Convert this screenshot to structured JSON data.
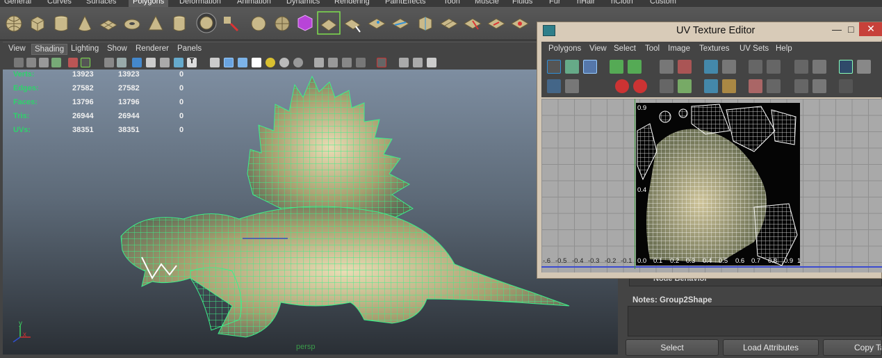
{
  "shelf": {
    "tabs": [
      "General",
      "Curves",
      "Surfaces",
      "Polygons",
      "Deformation",
      "Animation",
      "Dynamics",
      "Rendering",
      "PaintEffects",
      "Toon",
      "Muscle",
      "Fluids",
      "Fur",
      "nHair",
      "nCloth",
      "Custom"
    ],
    "active_tab": "Polygons"
  },
  "viewport": {
    "menu": [
      "View",
      "Shading",
      "Lighting",
      "Show",
      "Renderer",
      "Panels"
    ],
    "active_menu": "Shading",
    "camera_label": "persp",
    "axis": {
      "y": "y",
      "x": "x"
    },
    "hud": [
      {
        "label": "Verts:",
        "a": "13923",
        "b": "13923",
        "c": "0"
      },
      {
        "label": "Edges:",
        "a": "27582",
        "b": "27582",
        "c": "0"
      },
      {
        "label": "Faces:",
        "a": "13796",
        "b": "13796",
        "c": "0"
      },
      {
        "label": "Tris:",
        "a": "26944",
        "b": "26944",
        "c": "0"
      },
      {
        "label": "UVs:",
        "a": "38351",
        "b": "38351",
        "c": "0"
      }
    ]
  },
  "uv_editor": {
    "title": "UV Texture Editor",
    "window_controls": {
      "minimize": "—",
      "maximize": "□",
      "close": "✕"
    },
    "menu": [
      "Polygons",
      "View",
      "Select",
      "Tool",
      "Image",
      "Textures",
      "UV Sets",
      "Help"
    ],
    "x_ticks": [
      "-.6",
      "-0.5",
      "-0.4",
      "-0.3",
      "-0.2",
      "-0.1",
      "0.0",
      "0.1",
      "0.2",
      "0.3",
      "0.4",
      "0.5",
      "0.6",
      "0.7",
      "0.8",
      "0.9",
      "1"
    ],
    "y_ticks": [
      "0.9",
      "0.4"
    ]
  },
  "attributes": {
    "section": "Node Behavior",
    "notes_label": "Notes:  Group2Shape",
    "buttons": {
      "select": "Select",
      "load": "Load Attributes",
      "copy": "Copy Ta"
    }
  },
  "colors": {
    "wireframe": "#3cf08a",
    "hud_label": "#2fd26c",
    "window_close": "#c7413a",
    "active_tool": "#2f8fd8"
  }
}
